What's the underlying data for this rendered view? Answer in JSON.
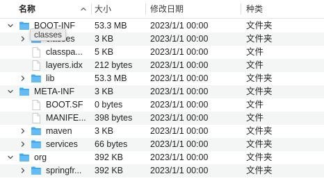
{
  "columns": {
    "name": "名称",
    "size": "大小",
    "date": "修改日期",
    "kind": "种类"
  },
  "tooltip": "classes",
  "rows": [
    {
      "name": "BOOT-INF",
      "size": "53.3 MB",
      "date": "2023/1/1 00:00",
      "kind": "文件夹"
    },
    {
      "name": "classes",
      "size": "3 KB",
      "date": "2023/1/1 00:00",
      "kind": "文件夹"
    },
    {
      "name": "classpa...",
      "size": "5 KB",
      "date": "2023/1/1 00:00",
      "kind": "文件"
    },
    {
      "name": "layers.idx",
      "size": "212 bytes",
      "date": "2023/1/1 00:00",
      "kind": "文件"
    },
    {
      "name": "lib",
      "size": "53.3 MB",
      "date": "2023/1/1 00:00",
      "kind": "文件夹"
    },
    {
      "name": "META-INF",
      "size": "3 KB",
      "date": "2023/1/1 00:00",
      "kind": "文件夹"
    },
    {
      "name": "BOOT.SF",
      "size": "0 bytes",
      "date": "2023/1/1 00:00",
      "kind": "文件"
    },
    {
      "name": "MANIFE...",
      "size": "398 bytes",
      "date": "2023/1/1 00:00",
      "kind": "文件"
    },
    {
      "name": "maven",
      "size": "3 KB",
      "date": "2023/1/1 00:00",
      "kind": "文件夹"
    },
    {
      "name": "services",
      "size": "66 bytes",
      "date": "2023/1/1 00:00",
      "kind": "文件夹"
    },
    {
      "name": "org",
      "size": "392 KB",
      "date": "2023/1/1 00:00",
      "kind": "文件夹"
    },
    {
      "name": "springfr...",
      "size": "392 KB",
      "date": "2023/1/1 00:00",
      "kind": "文件夹"
    }
  ]
}
